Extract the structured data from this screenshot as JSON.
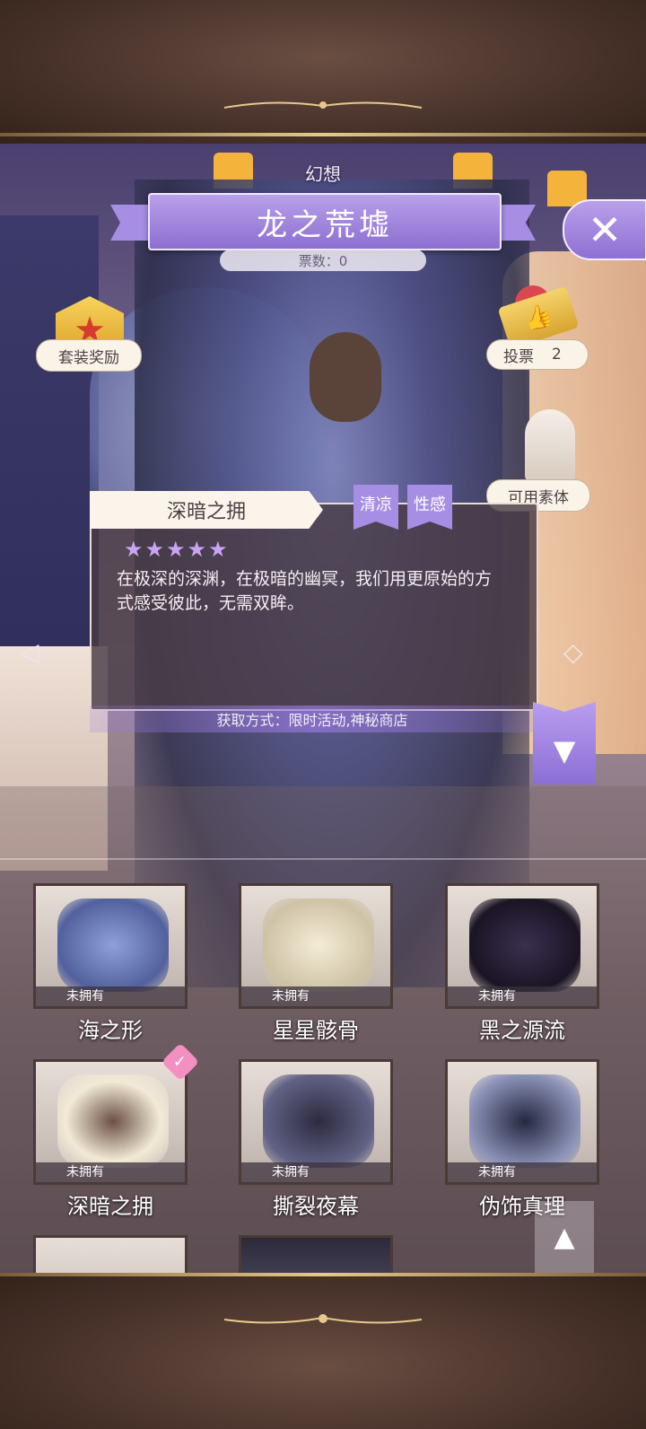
{
  "header": {
    "category": "幻想",
    "title": "龙之荒墟",
    "votes_label": "票数：0",
    "close_icon": "close-icon"
  },
  "sidebar_left": {
    "set_reward_label": "套装奖励"
  },
  "sidebar_right": {
    "vote_label": "投票",
    "vote_count": "2",
    "available_model_label": "可用素体"
  },
  "detail": {
    "item_name": "深暗之拥",
    "tags": [
      "清凉",
      "性感"
    ],
    "stars": "★★★★★",
    "star_count": 5,
    "description": "在极深的深渊，在极暗的幽冥，我们用更原始的方式感受彼此，无需双眸。",
    "acquire": "获取方式：限时活动,神秘商店"
  },
  "items": [
    {
      "name": "海之形",
      "status": "未拥有"
    },
    {
      "name": "星星骸骨",
      "status": "未拥有"
    },
    {
      "name": "黑之源流",
      "status": "未拥有"
    },
    {
      "name": "深暗之拥",
      "status": "未拥有",
      "selected": true
    },
    {
      "name": "撕裂夜幕",
      "status": "未拥有"
    },
    {
      "name": "伪饰真理",
      "status": "未拥有"
    }
  ],
  "colors": {
    "accent": "#9b82e0",
    "frame": "#4a342c",
    "gold": "#e8c98a"
  }
}
